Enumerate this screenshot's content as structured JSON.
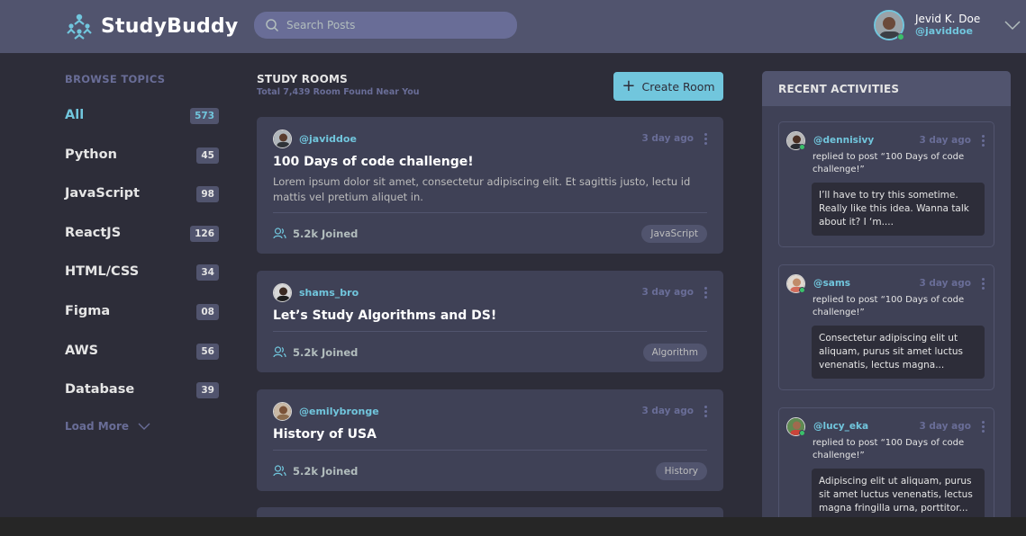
{
  "header": {
    "brand": "StudyBuddy",
    "search_placeholder": "Search Posts",
    "user_name": "Jevid K. Doe",
    "user_handle": "@javiddoe"
  },
  "sidebar": {
    "title": "BROWSE TOPICS",
    "topics": [
      {
        "label": "All",
        "count": "573"
      },
      {
        "label": "Python",
        "count": "45"
      },
      {
        "label": "JavaScript",
        "count": "98"
      },
      {
        "label": "ReactJS",
        "count": "126"
      },
      {
        "label": "HTML/CSS",
        "count": "34"
      },
      {
        "label": "Figma",
        "count": "08"
      },
      {
        "label": "AWS",
        "count": "56"
      },
      {
        "label": "Database",
        "count": "39"
      }
    ],
    "load_more": "Load More"
  },
  "rooms_section": {
    "title": "STUDY ROOMS",
    "subtitle": "Total 7,439 Room Found Near You",
    "create_label": "Create Room"
  },
  "rooms": [
    {
      "host": "@javiddoe",
      "time": "3 day ago",
      "title": "100 Days of code challenge!",
      "description": "Lorem ipsum dolor sit amet, consectetur adipiscing elit. Et sagittis justo, lectu id mattis vel pretium aliquet in.",
      "joined": "5.2k Joined",
      "tag": "JavaScript"
    },
    {
      "host": "shams_bro",
      "time": "3 day ago",
      "title": "Let’s Study Algorithms and DS!",
      "joined": "5.2k Joined",
      "tag": "Algorithm"
    },
    {
      "host": "@emilybronge",
      "time": "3 day ago",
      "title": "History of USA",
      "joined": "5.2k Joined",
      "tag": "History"
    }
  ],
  "activities": {
    "title": "RECENT ACTIVITIES",
    "items": [
      {
        "user": "@dennisivy",
        "time": "3 day ago",
        "reply": "replied to post  “100 Days of code challenge!”",
        "quote": "I’ll have to try this sometime. Really like this idea. Wanna talk about it? I ‘m...."
      },
      {
        "user": "@sams",
        "time": "3 day ago",
        "reply": "replied to post  “100 Days of code challenge!”",
        "quote": "Consectetur adipiscing elit ut aliquam, purus sit amet luctus venenatis, lectus magna..."
      },
      {
        "user": "@lucy_eka",
        "time": "3 day ago",
        "reply": "replied to post  “100 Days of code challenge!”",
        "quote": "Adipiscing elit ut aliquam, purus sit amet luctus venenatis, lectus magna fringilla urna, porttitor..."
      }
    ]
  },
  "colors": {
    "accent": "#71c6dd",
    "background": "#2d2d39",
    "header": "#51546e",
    "card": "#3f4156",
    "muted": "#696d97"
  }
}
